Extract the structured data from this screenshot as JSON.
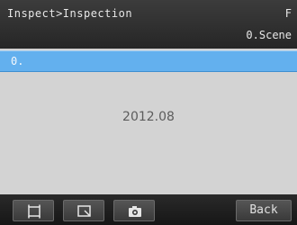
{
  "header": {
    "breadcrumb": "Inspect>Inspection",
    "corner_label": "F",
    "scene_label": "0.Scene"
  },
  "selection": {
    "label": "0."
  },
  "view": {
    "date_text": "2012.08"
  },
  "footer": {
    "back_label": "Back"
  },
  "icons": [
    "frame-icon",
    "zoom-icon",
    "camera-icon"
  ],
  "colors": {
    "header": "#2f2f2f",
    "selection": "#63b0ee",
    "view": "#d3d3d3",
    "footer": "#1e1e1e"
  }
}
